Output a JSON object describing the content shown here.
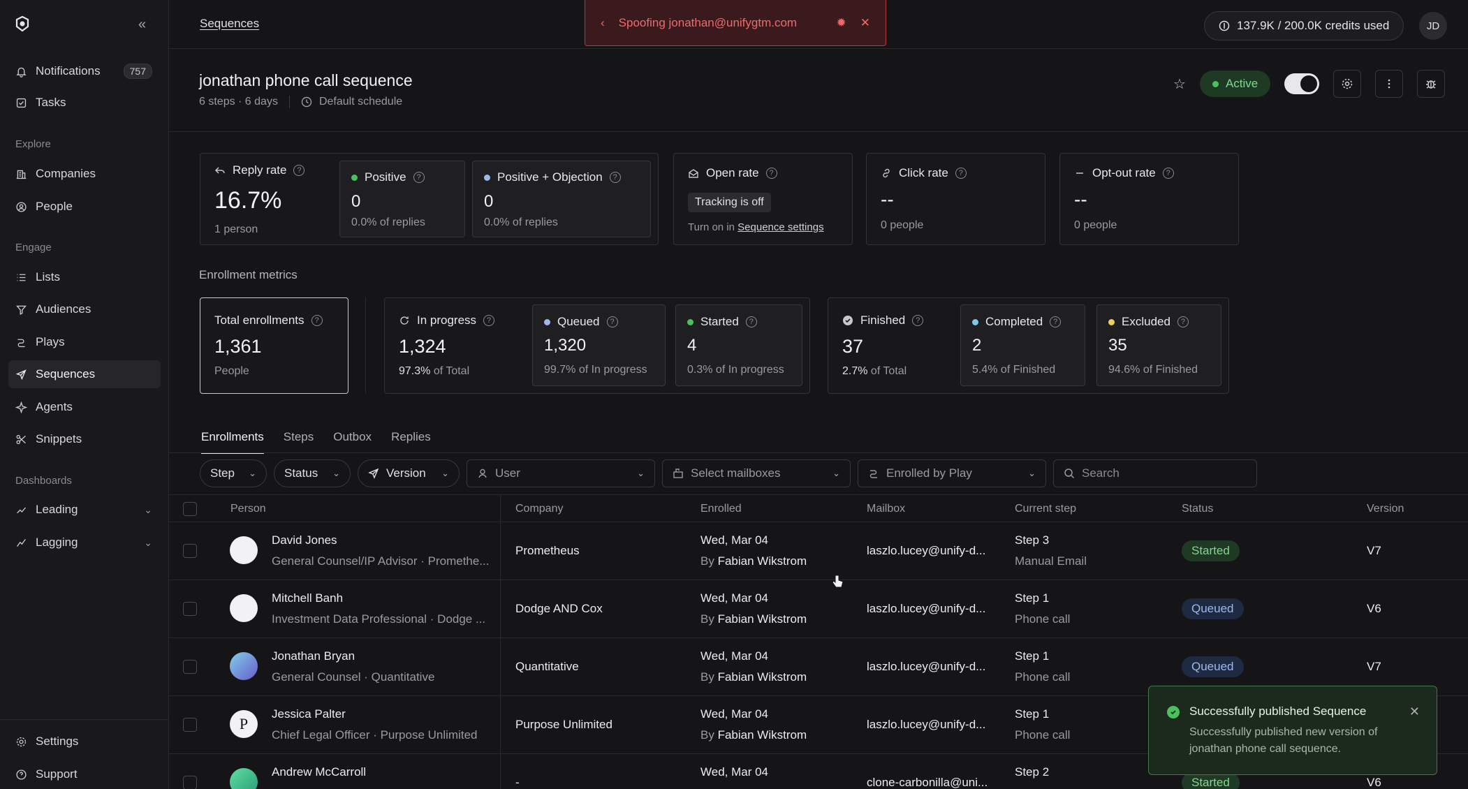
{
  "sidebar": {
    "notifications": {
      "label": "Notifications",
      "count": "757"
    },
    "tasks": "Tasks",
    "explore_heading": "Explore",
    "companies": "Companies",
    "people": "People",
    "engage_heading": "Engage",
    "lists": "Lists",
    "audiences": "Audiences",
    "plays": "Plays",
    "sequences": "Sequences",
    "agents": "Agents",
    "snippets": "Snippets",
    "dashboards_heading": "Dashboards",
    "leading": "Leading",
    "lagging": "Lagging",
    "settings": "Settings",
    "support": "Support"
  },
  "topbar": {
    "breadcrumb": "Sequences",
    "spoofing": "Spoofing jonathan@unifygtm.com",
    "credits": "137.9K / 200.0K credits used",
    "user_initials": "JD"
  },
  "header": {
    "title": "jonathan phone call sequence",
    "meta": "6 steps · 6 days",
    "schedule": "Default schedule",
    "status": "Active"
  },
  "metrics": {
    "reply_rate": {
      "label": "Reply rate",
      "value": "16.7%",
      "sub": "1 person"
    },
    "positive": {
      "label": "Positive",
      "value": "0",
      "sub": "0.0% of replies"
    },
    "positive_objection": {
      "label": "Positive + Objection",
      "value": "0",
      "sub": "0.0% of replies"
    },
    "open_rate": {
      "label": "Open rate",
      "pill": "Tracking is off",
      "sub_prefix": "Turn on in",
      "sub_link": "Sequence settings"
    },
    "click_rate": {
      "label": "Click rate",
      "value": "--",
      "sub": "0 people"
    },
    "opt_out_rate": {
      "label": "Opt-out rate",
      "value": "--",
      "sub": "0 people"
    }
  },
  "enrollment": {
    "heading": "Enrollment metrics",
    "total": {
      "label": "Total enrollments",
      "value": "1,361",
      "sub": "People"
    },
    "in_progress": {
      "label": "In progress",
      "value": "1,324",
      "sub_bold": "97.3%",
      "sub": "of Total"
    },
    "queued": {
      "label": "Queued",
      "value": "1,320",
      "sub": "99.7% of In progress"
    },
    "started": {
      "label": "Started",
      "value": "4",
      "sub": "0.3% of In progress"
    },
    "finished": {
      "label": "Finished",
      "value": "37",
      "sub_bold": "2.7%",
      "sub": "of Total"
    },
    "completed": {
      "label": "Completed",
      "value": "2",
      "sub": "5.4% of Finished"
    },
    "excluded": {
      "label": "Excluded",
      "value": "35",
      "sub": "94.6% of Finished"
    }
  },
  "tabs": [
    "Enrollments",
    "Steps",
    "Outbox",
    "Replies"
  ],
  "filters": {
    "step": "Step",
    "status": "Status",
    "version": "Version",
    "user": "User",
    "mailboxes": "Select mailboxes",
    "enrolled_by": "Enrolled by Play",
    "search_placeholder": "Search"
  },
  "table": {
    "columns": [
      "Person",
      "Company",
      "Enrolled",
      "Mailbox",
      "Current step",
      "Status",
      "Version"
    ],
    "rows": [
      {
        "name": "David Jones",
        "title": "General Counsel/IP Advisor · Promethe...",
        "company": "Prometheus",
        "date": "Wed, Mar 04",
        "by": "Fabian Wikstrom",
        "mailbox": "laszlo.lucey@unify-d...",
        "step": "Step 3",
        "step_type": "Manual Email",
        "status": "Started",
        "version": "V7"
      },
      {
        "name": "Mitchell Banh",
        "title": "Investment Data Professional · Dodge ...",
        "company": "Dodge AND Cox",
        "date": "Wed, Mar 04",
        "by": "Fabian Wikstrom",
        "mailbox": "laszlo.lucey@unify-d...",
        "step": "Step 1",
        "step_type": "Phone call",
        "status": "Queued",
        "version": "V6"
      },
      {
        "name": "Jonathan Bryan",
        "title": "General Counsel · Quantitative",
        "company": "Quantitative",
        "date": "Wed, Mar 04",
        "by": "Fabian Wikstrom",
        "mailbox": "laszlo.lucey@unify-d...",
        "step": "Step 1",
        "step_type": "Phone call",
        "status": "Queued",
        "version": "V7"
      },
      {
        "name": "Jessica Palter",
        "title": "Chief Legal Officer · Purpose Unlimited",
        "company": "Purpose Unlimited",
        "date": "Wed, Mar 04",
        "by": "Fabian Wikstrom",
        "mailbox": "laszlo.lucey@unify-d...",
        "step": "Step 1",
        "step_type": "Phone call",
        "status": "",
        "version": ""
      },
      {
        "name": "Andrew McCarroll",
        "title": "",
        "company": "-",
        "date": "Wed, Mar 04",
        "by": "",
        "mailbox": "clone-carbonilla@uni...",
        "step": "Step 2",
        "step_type": "",
        "status": "Started",
        "version": "V6"
      }
    ],
    "by_prefix": "By"
  },
  "toast": {
    "title": "Successfully published Sequence",
    "body": "Successfully published new version of jonathan phone call sequence."
  },
  "colors": {
    "accent_green": "#4cc05c",
    "queued_blue": "#9fb8ec",
    "danger": "#f06a6a"
  }
}
